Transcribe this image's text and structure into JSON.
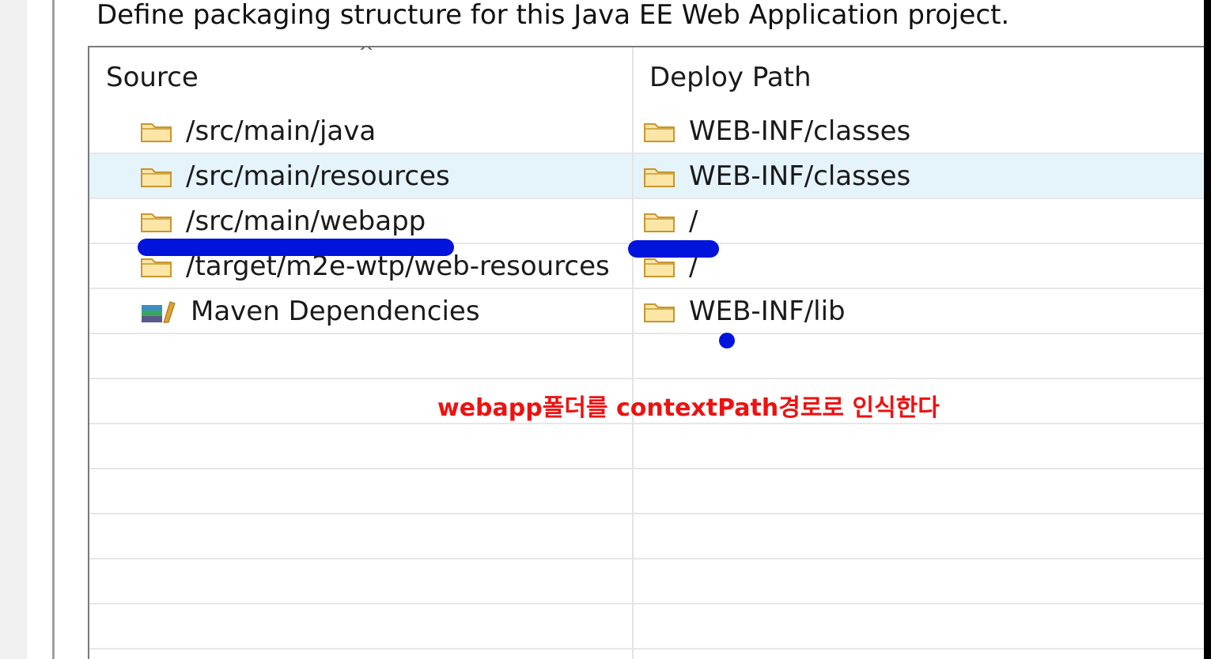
{
  "dialog": {
    "description": "Define packaging structure for this Java EE Web Application project."
  },
  "table": {
    "columns": {
      "source": "Source",
      "deploy_path": "Deploy Path"
    },
    "sort_indicator": "^",
    "rows": [
      {
        "source": "/src/main/java",
        "source_icon": "folder-icon",
        "deploy": "WEB-INF/classes",
        "deploy_icon": "folder-icon"
      },
      {
        "source": "/src/main/resources",
        "source_icon": "folder-icon",
        "deploy": "WEB-INF/classes",
        "deploy_icon": "folder-icon",
        "selected": true
      },
      {
        "source": "/src/main/webapp",
        "source_icon": "folder-icon",
        "deploy": "/",
        "deploy_icon": "folder-icon"
      },
      {
        "source": "/target/m2e-wtp/web-resources",
        "source_icon": "folder-icon",
        "deploy": "/",
        "deploy_icon": "folder-icon"
      },
      {
        "source": "Maven Dependencies",
        "source_icon": "library-icon",
        "deploy": "WEB-INF/lib",
        "deploy_icon": "folder-icon"
      }
    ]
  },
  "annotation": {
    "text": "webapp폴더를 contextPath경로로 인식한다",
    "color": "#ee1111",
    "marker_color": "#0014dc"
  }
}
